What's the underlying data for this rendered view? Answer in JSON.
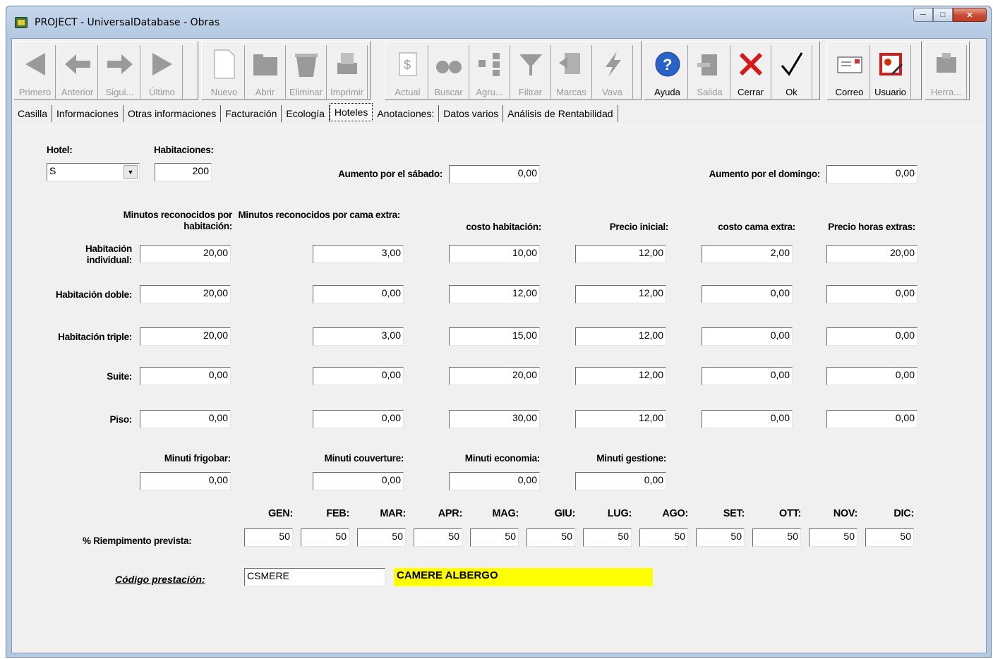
{
  "window": {
    "title": "PROJECT - UniversalDatabase - Obras",
    "controls": [
      "minimize",
      "maximize",
      "close"
    ]
  },
  "toolbar": [
    {
      "label": "Primero",
      "icon": "first-arrow-icon",
      "enabled": false
    },
    {
      "label": "Anterior",
      "icon": "previous-arrow-icon",
      "enabled": false
    },
    {
      "label": "Sigui...",
      "icon": "next-arrow-icon",
      "enabled": false
    },
    {
      "label": "Último",
      "icon": "last-arrow-icon",
      "enabled": false
    },
    {
      "label": "Nuevo",
      "icon": "new-document-icon",
      "enabled": false
    },
    {
      "label": "Abrir",
      "icon": "folder-icon",
      "enabled": false
    },
    {
      "label": "Eliminar",
      "icon": "trash-icon",
      "enabled": false
    },
    {
      "label": "Imprimir",
      "icon": "printer-icon",
      "enabled": false
    },
    {
      "label": "Actual",
      "icon": "refresh-icon",
      "enabled": false
    },
    {
      "label": "Buscar",
      "icon": "binoculars-icon",
      "enabled": false
    },
    {
      "label": "Agru...",
      "icon": "group-icon",
      "enabled": false
    },
    {
      "label": "Filtrar",
      "icon": "filter-icon",
      "enabled": false
    },
    {
      "label": "Marcas",
      "icon": "bookmark-icon",
      "enabled": false
    },
    {
      "label": "Vava",
      "icon": "lightning-icon",
      "enabled": false
    },
    {
      "label": "Ayuda",
      "icon": "help-icon",
      "enabled": true
    },
    {
      "label": "Salida",
      "icon": "exit-icon",
      "enabled": false
    },
    {
      "label": "Cerrar",
      "icon": "close-x-icon",
      "enabled": true
    },
    {
      "label": "Ok",
      "icon": "checkmark-icon",
      "enabled": true
    },
    {
      "label": "Correo",
      "icon": "mail-icon",
      "enabled": true
    },
    {
      "label": "Usuario",
      "icon": "user-icon",
      "enabled": true
    },
    {
      "label": "Herra...",
      "icon": "tools-icon",
      "enabled": false
    }
  ],
  "tabs": [
    "Casilla",
    "Informaciones",
    "Otras informaciones",
    "Facturación",
    "Ecología",
    "Hoteles",
    "Anotaciones:",
    "Datos varios",
    "Análisis de Rentabilidad"
  ],
  "active_tab": "Hoteles",
  "form": {
    "hotel_label": "Hotel:",
    "hotel_value": "S",
    "habitaciones_label": "Habitaciones:",
    "habitaciones_value": "200",
    "aumento_sabado_label": "Aumento por el sábado:",
    "aumento_sabado_value": "0,00",
    "aumento_domingo_label": "Aumento por el domingo:",
    "aumento_domingo_value": "0,00",
    "col_headers": [
      "Minutos reconocidos por habitación:",
      "Minutos reconocidos por cama extra:",
      "costo habitación:",
      "Precio inicial:",
      "costo cama extra:",
      "Precio horas extras:"
    ],
    "rows": [
      {
        "label": "Habitación individual:",
        "values": [
          "20,00",
          "3,00",
          "10,00",
          "12,00",
          "2,00",
          "20,00"
        ]
      },
      {
        "label": "Habitación doble:",
        "values": [
          "20,00",
          "0,00",
          "12,00",
          "12,00",
          "0,00",
          "0,00"
        ]
      },
      {
        "label": "Habitación triple:",
        "values": [
          "20,00",
          "3,00",
          "15,00",
          "12,00",
          "0,00",
          "0,00"
        ]
      },
      {
        "label": "Suite:",
        "values": [
          "0,00",
          "0,00",
          "20,00",
          "12,00",
          "0,00",
          "0,00"
        ]
      },
      {
        "label": "Piso:",
        "values": [
          "0,00",
          "0,00",
          "30,00",
          "12,00",
          "0,00",
          "0,00"
        ]
      }
    ],
    "minuti": [
      {
        "label": "Minuti frigobar:",
        "value": "0,00"
      },
      {
        "label": "Minuti couverture:",
        "value": "0,00"
      },
      {
        "label": "Minuti economia:",
        "value": "0,00"
      },
      {
        "label": "Minuti gestione:",
        "value": "0,00"
      }
    ],
    "months": [
      "GEN:",
      "FEB:",
      "MAR:",
      "APR:",
      "MAG:",
      "GIU:",
      "LUG:",
      "AGO:",
      "SET:",
      "OTT:",
      "NOV:",
      "DIC:"
    ],
    "riempimento_label": "% Riempimento prevista:",
    "riempimento_values": [
      "50",
      "50",
      "50",
      "50",
      "50",
      "50",
      "50",
      "50",
      "50",
      "50",
      "50",
      "50"
    ],
    "codigo_label": "Código prestación:",
    "codigo_value": "CSMERE",
    "codigo_desc": "CAMERE ALBERGO"
  }
}
